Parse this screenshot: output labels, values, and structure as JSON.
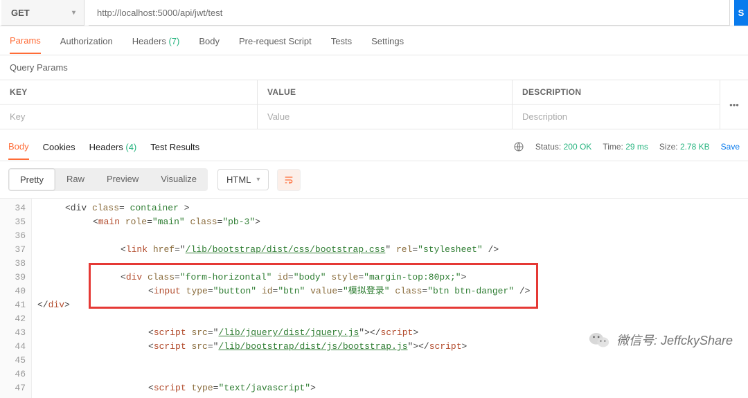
{
  "request": {
    "method": "GET",
    "url": "http://localhost:5000/api/jwt/test",
    "send_label": "S"
  },
  "req_tabs": [
    "Params",
    "Authorization",
    "Headers",
    "Body",
    "Pre-request Script",
    "Tests",
    "Settings"
  ],
  "headers_count": "(7)",
  "query_params_label": "Query Params",
  "params_table": {
    "key_header": "KEY",
    "value_header": "VALUE",
    "desc_header": "DESCRIPTION",
    "key_ph": "Key",
    "value_ph": "Value",
    "desc_ph": "Description"
  },
  "resp_tabs": [
    "Body",
    "Cookies",
    "Headers",
    "Test Results"
  ],
  "resp_headers_count": "(4)",
  "status": {
    "label": "Status:",
    "code": "200",
    "text": "OK",
    "time_label": "Time:",
    "time": "29 ms",
    "size_label": "Size:",
    "size": "2.78 KB",
    "save": "Save"
  },
  "viewer": {
    "modes": [
      "Pretty",
      "Raw",
      "Preview",
      "Visualize"
    ],
    "lang": "HTML"
  },
  "code": {
    "line_start": 34,
    "line_end": 47,
    "l34a": "<div",
    "l34b": "class",
    "l34c": "container",
    "l34d": ">",
    "l35a": "<main",
    "l35_role_k": "role",
    "l35_role_v": "\"main\"",
    "l35_cls_k": "class",
    "l35_cls_v": "\"pb-3\"",
    "l35end": ">",
    "l37a": "<link",
    "l37_href_k": "href",
    "l37_href_v": "/lib/bootstrap/dist/css/bootstrap.css",
    "l37_rel_k": "rel",
    "l37_rel_v": "\"stylesheet\"",
    "l37end": "/>",
    "l39a": "<div",
    "l39_cls_k": "class",
    "l39_cls_v": "\"form-horizontal\"",
    "l39_id_k": "id",
    "l39_id_v": "\"body\"",
    "l39_sty_k": "style",
    "l39_sty_v": "\"margin-top:80px;\"",
    "l39end": ">",
    "l40a": "<input",
    "l40_type_k": "type",
    "l40_type_v": "\"button\"",
    "l40_id_k": "id",
    "l40_id_v": "\"btn\"",
    "l40_val_k": "value",
    "l40_val_v": "\"模拟登录\"",
    "l40_cls_k": "class",
    "l40_cls_v": "\"btn btn-danger\"",
    "l40end": "/>",
    "l41": "</div>",
    "l43a": "<script",
    "l43_src_k": "src",
    "l43_src_v": "/lib/jquery/dist/jquery.js",
    "l43close": "></",
    "l43close2": "script",
    "l43close3": ">",
    "l44a": "<script",
    "l44_src_k": "src",
    "l44_src_v": "/lib/bootstrap/dist/js/bootstrap.js",
    "l44close": "></",
    "l44close2": "script",
    "l44close3": ">",
    "l47a": "<script",
    "l47_type_k": "type",
    "l47_type_v": "\"text/javascript\"",
    "l47end": ">"
  },
  "watermark": "微信号: JeffckyShare"
}
